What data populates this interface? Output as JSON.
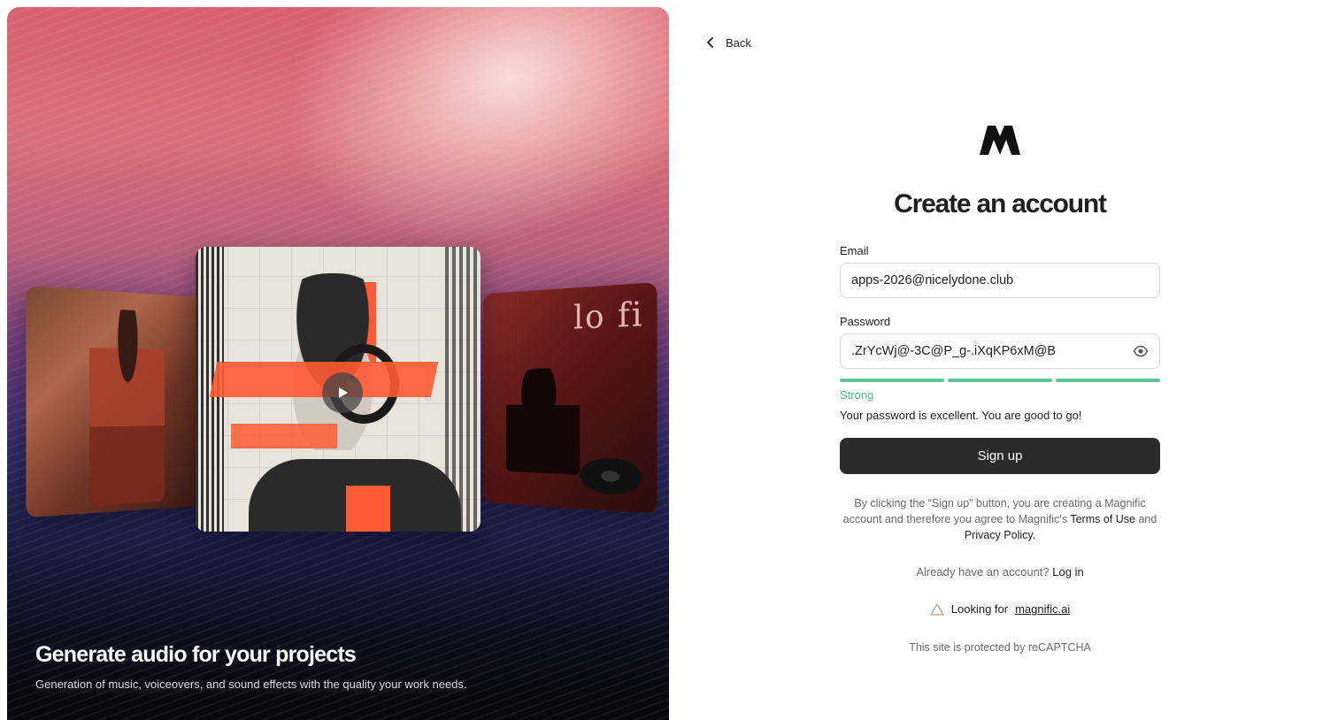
{
  "hero": {
    "title": "Generate audio for your projects",
    "subtitle": "Generation of music, voiceovers, and sound effects with the quality your work needs.",
    "cards": {
      "right_text": "lo  fi"
    }
  },
  "nav": {
    "back_label": "Back"
  },
  "form": {
    "title": "Create an account",
    "email_label": "Email",
    "email_value": "apps-2026@nicelydone.club",
    "password_label": "Password",
    "password_value": ".ZrYcWj@-3C@P_g-.iXqKP6xM@B",
    "strength_label": "Strong",
    "strength_message": "Your password is excellent. You are good to go!",
    "signup_label": "Sign up",
    "terms_prefix": "By clicking the “Sign up” button, you are creating a Magnific account and therefore you agree to Magnific’s",
    "terms_link": "Terms of Use",
    "terms_and": "and",
    "privacy_link": "Privacy Policy.",
    "already_text": "Already have an account?",
    "login_link": "Log in",
    "looking_text": "Looking for",
    "looking_link": "magnific.ai",
    "captcha_text": "This site is protected by reCAPTCHA"
  },
  "colors": {
    "button_bg": "#2b2b2b",
    "strength_green": "#5fc592",
    "strength_text": "#4fb884"
  }
}
